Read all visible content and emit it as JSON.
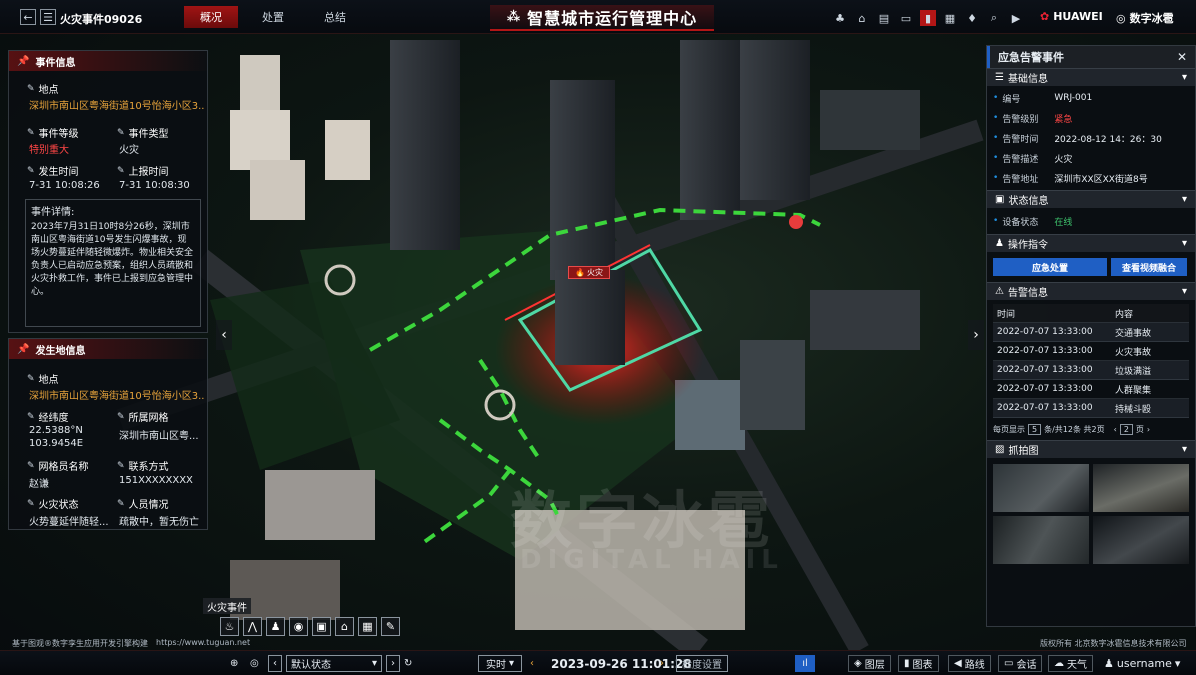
{
  "topbar": {
    "event_title": "火灾事件09026",
    "tabs": [
      {
        "label": "概况",
        "active": true
      },
      {
        "label": "处置",
        "active": false
      },
      {
        "label": "总结",
        "active": false
      }
    ],
    "center_title": "智慧城市运行管理中心",
    "brand_huawei": "HUAWEI",
    "brand_ice": "数字冰雹",
    "tool_icons": [
      "org-icon",
      "home-icon",
      "layers-icon",
      "print-icon",
      "chart-icon",
      "grid-icon",
      "bell-icon",
      "search-icon",
      "video-icon"
    ]
  },
  "left_event": {
    "header": "事件信息",
    "location_label": "地点",
    "location_value": "深圳市南山区粤海街道10号怡海小区3...",
    "level_label": "事件等级",
    "level_value": "特别重大",
    "type_label": "事件类型",
    "type_value": "火灾",
    "occur_label": "发生时间",
    "occur_value": "7-31 10:08:26",
    "report_label": "上报时间",
    "report_value": "7-31 10:08:30",
    "detail_label": "事件详情:",
    "detail_text": "2023年7月31日10时8分26秒，深圳市南山区粤海街道10号发生闪爆事故，现场火势蔓延伴随轻微爆炸。物业相关安全负责人已启动应急预案，组织人员疏散和火灾扑救工作，事件已上报到应急管理中心。"
  },
  "left_site": {
    "header": "发生地信息",
    "location_label": "地点",
    "location_value": "深圳市南山区粤海街道10号怡海小区3...",
    "coord_label": "经纬度",
    "coord_value1": "22.5388°N",
    "coord_value2": "103.9454E",
    "grid_label": "所属网格",
    "grid_value": "深圳市南山区粤...",
    "member_label": "网格员名称",
    "member_value": "赵谦",
    "contact_label": "联系方式",
    "contact_value": "151XXXXXXXX",
    "fire_label": "火灾状态",
    "fire_value": "火势蔓延伴随轻...",
    "people_label": "人员情况",
    "people_value": "疏散中，暂无伤亡"
  },
  "map": {
    "fire_tag": "火灾",
    "tooltip": "火灾事件",
    "footer_left": "基于图观®数字孪生应用开发引擎构建",
    "footer_url": "https://www.tuguan.net",
    "footer_right": "版权所有 北京数字冰雹信息技术有限公司",
    "watermark_cn": "数字冰雹",
    "watermark_en": "DIGITAL HAIL",
    "tools": [
      "fire-tool-icon",
      "route-tool-icon",
      "person-tool-icon",
      "camera-tool-icon",
      "vehicle-tool-icon",
      "building-tool-icon",
      "map-tool-icon",
      "pen-tool-icon"
    ]
  },
  "right": {
    "header": "应急告警事件",
    "basic_header": "基础信息",
    "basic_rows": [
      {
        "k": "编号",
        "v": "WRJ-001",
        "color": "#e8eef4"
      },
      {
        "k": "告警级别",
        "v": "紧急",
        "color": "#ff4646"
      },
      {
        "k": "告警时间",
        "v": "2022-08-12 14：26：30",
        "color": "#e8eef4"
      },
      {
        "k": "告警描述",
        "v": "火灾",
        "color": "#e8eef4"
      },
      {
        "k": "告警地址",
        "v": "深圳市XX区XX街道8号",
        "color": "#e8eef4"
      }
    ],
    "status_header": "状态信息",
    "device_label": "设备状态",
    "device_value": "在线",
    "command_header": "操作指令",
    "btn_emergency": "应急处置",
    "btn_video": "查看视频融合",
    "alarm_header": "告警信息",
    "table_cols": [
      "时间",
      "内容"
    ],
    "table_rows": [
      {
        "time": "2022-07-07 13:33:00",
        "content": "交通事故"
      },
      {
        "time": "2022-07-07 13:33:00",
        "content": "火灾事故"
      },
      {
        "time": "2022-07-07 13:33:00",
        "content": "垃圾满溢"
      },
      {
        "time": "2022-07-07 13:33:00",
        "content": "人群聚集"
      },
      {
        "time": "2022-07-07 13:33:00",
        "content": "持械斗殴"
      }
    ],
    "pager_show": "每页显示",
    "pager_size": "5",
    "pager_total": "条/共12条 共2页",
    "pager_page": "2",
    "pager_unit": "页",
    "snapshot_header": "抓拍图"
  },
  "bottombar": {
    "status_select": "默认状态",
    "realtime": "实时",
    "datetime": "2023-09-26 11:01:28",
    "speed_set": "检度设置",
    "btn_layers": "图层",
    "btn_charts": "图表",
    "btn_route": "路线",
    "btn_meeting": "会话",
    "btn_weather": "天气",
    "username": "username"
  },
  "colors": {
    "accent_red": "#b31616",
    "primary_blue": "#1f5fc4",
    "warn_orange": "#e8a43b",
    "online_green": "#3ec46d"
  }
}
